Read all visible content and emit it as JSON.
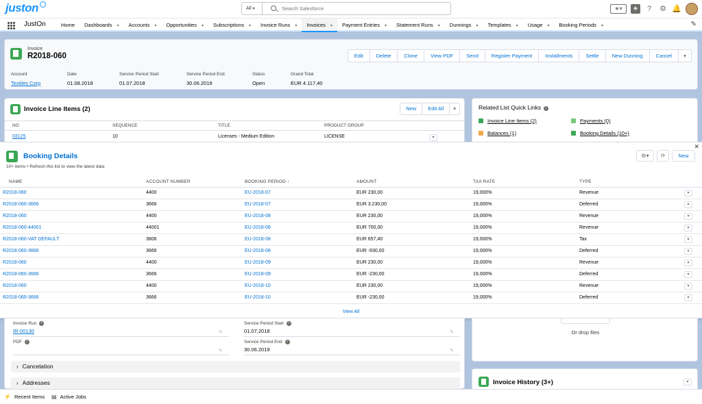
{
  "header": {
    "logo": "juston",
    "search_scope": "All",
    "search_placeholder": "Search Salesforce"
  },
  "nav": {
    "app_name": "JustOn",
    "items": [
      {
        "label": "Home",
        "chevron": false
      },
      {
        "label": "Dashboards",
        "chevron": true
      },
      {
        "label": "Accounts",
        "chevron": true
      },
      {
        "label": "Opportunities",
        "chevron": true
      },
      {
        "label": "Subscriptions",
        "chevron": true
      },
      {
        "label": "Invoice Runs",
        "chevron": true
      },
      {
        "label": "Invoices",
        "chevron": true,
        "active": true
      },
      {
        "label": "Payment Entries",
        "chevron": true
      },
      {
        "label": "Statement Runs",
        "chevron": true
      },
      {
        "label": "Dunnings",
        "chevron": true
      },
      {
        "label": "Templates",
        "chevron": true
      },
      {
        "label": "Usage",
        "chevron": true
      },
      {
        "label": "Booking Periods",
        "chevron": true
      }
    ]
  },
  "record": {
    "object_label": "Invoice",
    "title": "R2018-060",
    "actions": [
      "Edit",
      "Delete",
      "Clone",
      "View PDF",
      "Send",
      "Register Payment",
      "Installments",
      "Settle",
      "New Dunning",
      "Cancel"
    ],
    "highlights": [
      {
        "label": "Account",
        "value": "Textiles Corp",
        "link": true
      },
      {
        "label": "Date",
        "value": "01.08.2018"
      },
      {
        "label": "Service Period Start",
        "value": "01.07.2018"
      },
      {
        "label": "Service Period End",
        "value": "30.06.2019"
      },
      {
        "label": "Status",
        "value": "Open"
      },
      {
        "label": "Grand Total",
        "value": "EUR 4.117,40"
      }
    ]
  },
  "line_items": {
    "title": "Invoice Line Items (2)",
    "new_label": "New",
    "edit_all_label": "Edit All",
    "columns": [
      "NO",
      "SEQUENCE",
      "TITLE",
      "PRODUCT GROUP"
    ],
    "row": [
      "03125",
      "10",
      "Licenses - Medium Edition",
      "LICENSE"
    ]
  },
  "quick_links": {
    "title": "Related List Quick Links",
    "links": [
      {
        "label": "Invoice Line Items (2)",
        "color": "#3ba755"
      },
      {
        "label": "Payments (0)",
        "color": "#7bc67b"
      },
      {
        "label": "Balances (1)",
        "color": "#f2a94a"
      },
      {
        "label": "Booking Details (10+)",
        "color": "#3ba755"
      }
    ]
  },
  "booking": {
    "title": "Booking Details",
    "subtitle": "10+ items • Refresh this list to view the latest data",
    "new_label": "New",
    "columns": [
      "NAME",
      "ACCOUNT NUMBER",
      "BOOKING PERIOD ↑",
      "AMOUNT",
      "TAX RATE",
      "TYPE"
    ],
    "rows": [
      [
        "R2018-060",
        "4400",
        "EU-2018-07",
        "EUR 230,00",
        "19,000%",
        "Revenue"
      ],
      [
        "R2018-060-3666",
        "3666",
        "EU-2018-07",
        "EUR 3.230,00",
        "19,000%",
        "Deferred"
      ],
      [
        "R2018-060",
        "4400",
        "EU-2018-08",
        "EUR 230,00",
        "19,000%",
        "Revenue"
      ],
      [
        "R2018-060-44001",
        "44001",
        "EU-2018-08",
        "EUR 700,00",
        "19,000%",
        "Revenue"
      ],
      [
        "R2018-060-VAT DEFAULT",
        "3806",
        "EU-2018-08",
        "EUR 657,40",
        "19,000%",
        "Tax"
      ],
      [
        "R2018-060-3666",
        "3666",
        "EU-2018-08",
        "EUR -930,00",
        "19,000%",
        "Deferred"
      ],
      [
        "R2018-060",
        "4400",
        "EU-2018-09",
        "EUR 230,00",
        "19,000%",
        "Revenue"
      ],
      [
        "R2018-060-3666",
        "3666",
        "EU-2018-09",
        "EUR -230,00",
        "19,000%",
        "Deferred"
      ],
      [
        "R2018-060",
        "4400",
        "EU-2018-10",
        "EUR 230,00",
        "19,000%",
        "Revenue"
      ],
      [
        "R2018-060-3666",
        "3666",
        "EU-2018-10",
        "EUR -230,00",
        "19,000%",
        "Deferred"
      ]
    ],
    "view_all": "View All"
  },
  "details": {
    "invoice_run_label": "Invoice Run",
    "invoice_run_value": "IR-00130",
    "pdf_label": "PDF",
    "sps_label": "Service Period Start",
    "sps_value": "01.07.2018",
    "spe_label": "Service Period End",
    "spe_value": "30.06.2019",
    "section_cancelation": "Cancelation",
    "section_addresses": "Addresses"
  },
  "files": {
    "drop_label": "Or drop files"
  },
  "history": {
    "title": "Invoice History (3+)"
  },
  "utility": {
    "recent_items": "Recent Items",
    "active_jobs": "Active Jobs"
  }
}
